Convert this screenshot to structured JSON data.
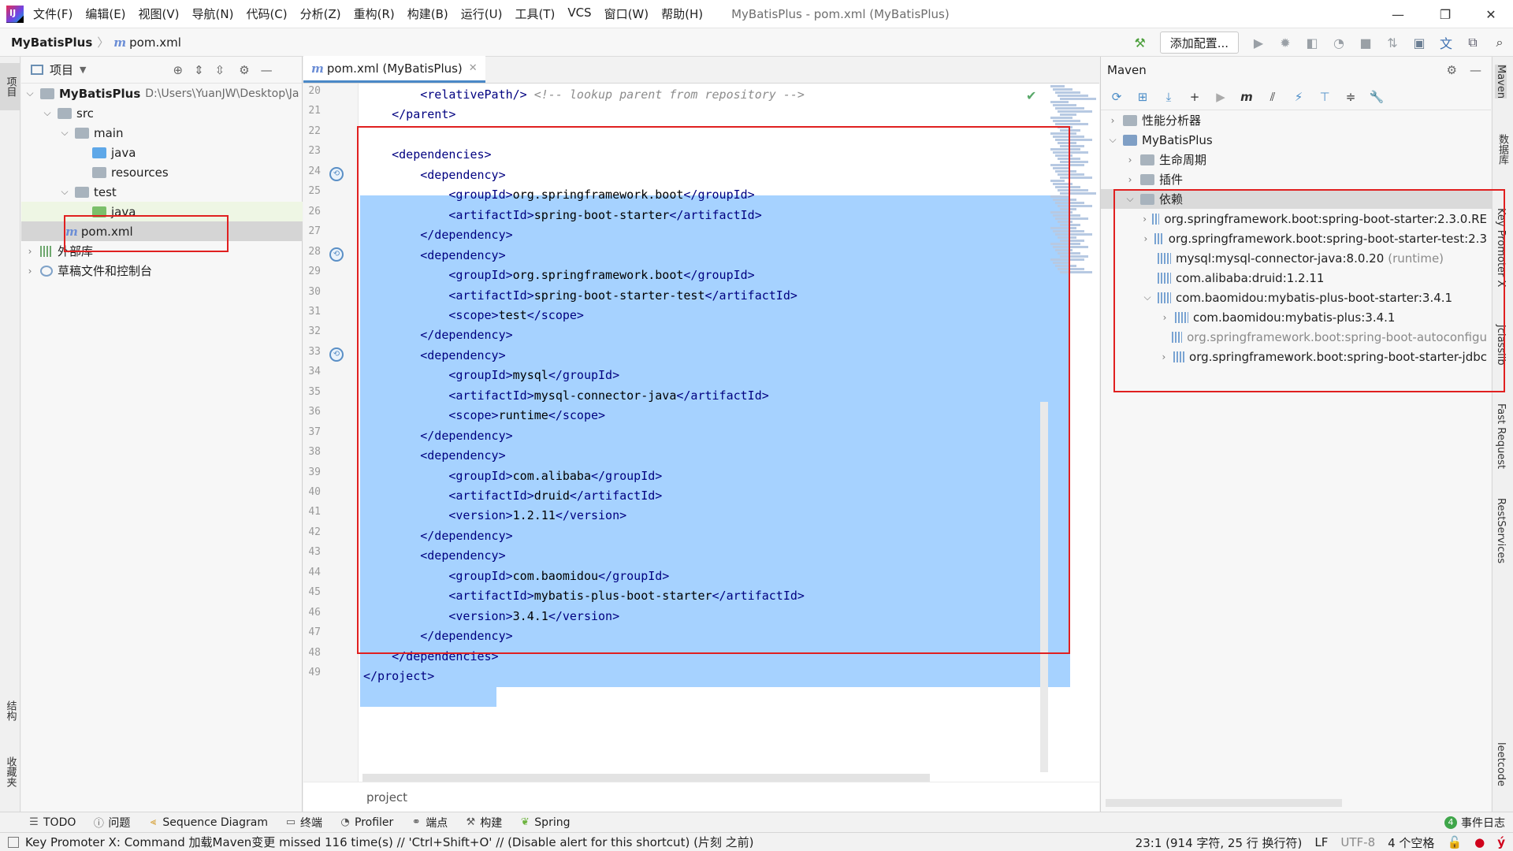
{
  "app": {
    "logo_text": "IJ",
    "window_title": "MyBatisPlus - pom.xml (MyBatisPlus)"
  },
  "menu": [
    "文件(F)",
    "编辑(E)",
    "视图(V)",
    "导航(N)",
    "代码(C)",
    "分析(Z)",
    "重构(R)",
    "构建(B)",
    "运行(U)",
    "工具(T)",
    "VCS",
    "窗口(W)",
    "帮助(H)"
  ],
  "window_controls": {
    "minimize": "—",
    "restore": "❐",
    "close": "✕"
  },
  "nav": {
    "project": "MyBatisPlus",
    "file": "pom.xml",
    "add_config": "添加配置..."
  },
  "left_stripe": {
    "project_tab": "项目",
    "structure_tab": "结构",
    "favorites_tab": "收藏夹"
  },
  "project_panel": {
    "title": "项目",
    "tree": [
      {
        "label": "MyBatisPlus",
        "path": "D:\\Users\\YuanJW\\Desktop\\Ja"
      },
      {
        "label": "src"
      },
      {
        "label": "main"
      },
      {
        "label": "java"
      },
      {
        "label": "resources"
      },
      {
        "label": "test"
      },
      {
        "label": "java"
      },
      {
        "label": "pom.xml"
      },
      {
        "label": "外部库"
      },
      {
        "label": "草稿文件和控制台"
      }
    ]
  },
  "editor": {
    "tab_label": "pom.xml (MyBatisPlus)",
    "breadcrumb": "project",
    "line_numbers": [
      "20",
      "21",
      "22",
      "23",
      "24",
      "25",
      "26",
      "27",
      "28",
      "29",
      "30",
      "31",
      "32",
      "33",
      "34",
      "35",
      "36",
      "37",
      "38",
      "39",
      "40",
      "41",
      "42",
      "43",
      "44",
      "45",
      "46",
      "47",
      "48",
      "49"
    ],
    "lines": [
      {
        "indent": "        ",
        "tag_open": "<relativePath/>",
        "text": " ",
        "comment": "<!-- lookup parent from repository -->"
      },
      {
        "indent": "    ",
        "tag_open": "</parent>"
      },
      {
        "indent": ""
      },
      {
        "indent": "    ",
        "tag_open": "<dependencies>"
      },
      {
        "indent": "        ",
        "tag_open": "<dependency>"
      },
      {
        "indent": "            ",
        "tag_open": "<groupId>",
        "text": "org.springframework.boot",
        "tag_close": "</groupId>"
      },
      {
        "indent": "            ",
        "tag_open": "<artifactId>",
        "text": "spring-boot-starter",
        "tag_close": "</artifactId>"
      },
      {
        "indent": "        ",
        "tag_open": "</dependency>"
      },
      {
        "indent": "        ",
        "tag_open": "<dependency>"
      },
      {
        "indent": "            ",
        "tag_open": "<groupId>",
        "text": "org.springframework.boot",
        "tag_close": "</groupId>"
      },
      {
        "indent": "            ",
        "tag_open": "<artifactId>",
        "text": "spring-boot-starter-test",
        "tag_close": "</artifactId>"
      },
      {
        "indent": "            ",
        "tag_open": "<scope>",
        "text": "test",
        "tag_close": "</scope>"
      },
      {
        "indent": "        ",
        "tag_open": "</dependency>"
      },
      {
        "indent": "        ",
        "tag_open": "<dependency>"
      },
      {
        "indent": "            ",
        "tag_open": "<groupId>",
        "text": "mysql",
        "tag_close": "</groupId>"
      },
      {
        "indent": "            ",
        "tag_open": "<artifactId>",
        "text": "mysql-connector-java",
        "tag_close": "</artifactId>"
      },
      {
        "indent": "            ",
        "tag_open": "<scope>",
        "text": "runtime",
        "tag_close": "</scope>"
      },
      {
        "indent": "        ",
        "tag_open": "</dependency>"
      },
      {
        "indent": "        ",
        "tag_open": "<dependency>"
      },
      {
        "indent": "            ",
        "tag_open": "<groupId>",
        "text": "com.alibaba",
        "tag_close": "</groupId>"
      },
      {
        "indent": "            ",
        "tag_open": "<artifactId>",
        "text": "druid",
        "tag_close": "</artifactId>"
      },
      {
        "indent": "            ",
        "tag_open": "<version>",
        "text": "1.2.11",
        "tag_close": "</version>"
      },
      {
        "indent": "        ",
        "tag_open": "</dependency>"
      },
      {
        "indent": "        ",
        "tag_open": "<dependency>"
      },
      {
        "indent": "            ",
        "tag_open": "<groupId>",
        "text": "com.baomidou",
        "tag_close": "</groupId>"
      },
      {
        "indent": "            ",
        "tag_open": "<artifactId>",
        "text": "mybatis-plus-boot-starter",
        "tag_close": "</artifactId>"
      },
      {
        "indent": "            ",
        "tag_open": "<version>",
        "text": "3.4.1",
        "tag_close": "</version>"
      },
      {
        "indent": "        ",
        "tag_open": "</dependency>"
      },
      {
        "indent": "    ",
        "tag_open": "</dependencies>"
      },
      {
        "indent": "",
        "tag_open": "</project>"
      }
    ]
  },
  "maven": {
    "title": "Maven",
    "tree": [
      {
        "label": "性能分析器"
      },
      {
        "label": "MyBatisPlus"
      },
      {
        "label": "生命周期"
      },
      {
        "label": "插件"
      },
      {
        "label": "依赖"
      },
      {
        "label": "org.springframework.boot:spring-boot-starter:2.3.0.RE"
      },
      {
        "label": "org.springframework.boot:spring-boot-starter-test:2.3"
      },
      {
        "label": "mysql:mysql-connector-java:8.0.20",
        "note": "(runtime)"
      },
      {
        "label": "com.alibaba:druid:1.2.11"
      },
      {
        "label": "com.baomidou:mybatis-plus-boot-starter:3.4.1"
      },
      {
        "label": "com.baomidou:mybatis-plus:3.4.1"
      },
      {
        "label": "org.springframework.boot:spring-boot-autoconfigu"
      },
      {
        "label": "org.springframework.boot:spring-boot-starter-jdbc"
      }
    ]
  },
  "right_stripe": [
    "Maven",
    "数据库",
    "Key Promoter X",
    "Jclasslib",
    "Fast Request",
    "RestServices",
    "leetcode"
  ],
  "bottom_tools": [
    "TODO",
    "问题",
    "Sequence Diagram",
    "终端",
    "Profiler",
    "端点",
    "构建",
    "Spring"
  ],
  "event_log": {
    "count": "4",
    "label": "事件日志"
  },
  "status": {
    "message": "Key Promoter X: Command 加载Maven变更 missed 116 time(s) // 'Ctrl+Shift+O' // (Disable alert for this shortcut) (片刻 之前)",
    "position": "23:1 (914 字符, 25 行 换行符)",
    "line_sep": "LF",
    "encoding": "UTF-8",
    "indent": "4 个空格"
  },
  "colors": {
    "selection": "#a6d2ff",
    "annotation": "#e02020",
    "xml_tag": "#000080"
  }
}
